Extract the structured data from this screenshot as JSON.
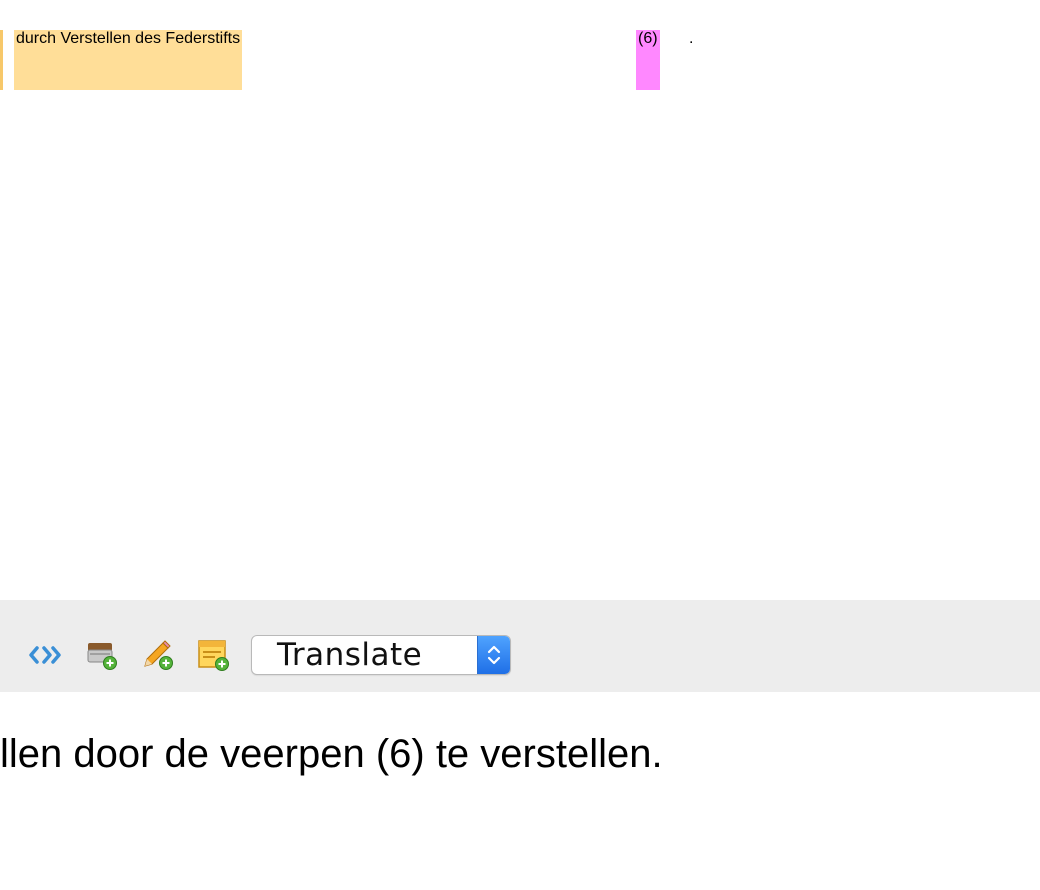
{
  "source": {
    "highlighted_text": "durch Verstellen des Federstifts",
    "tag_text": "(6)",
    "trailing_punct": ".",
    "highlight_color": "#ffde98",
    "tag_color": "#ff88ff"
  },
  "toolbar": {
    "icons": [
      "tag-insert-icon",
      "add-term-icon",
      "add-edit-icon",
      "add-note-icon"
    ],
    "translate_select": {
      "value": "Translate"
    }
  },
  "target": {
    "text": "llen door de veerpen (6) te verstellen."
  }
}
